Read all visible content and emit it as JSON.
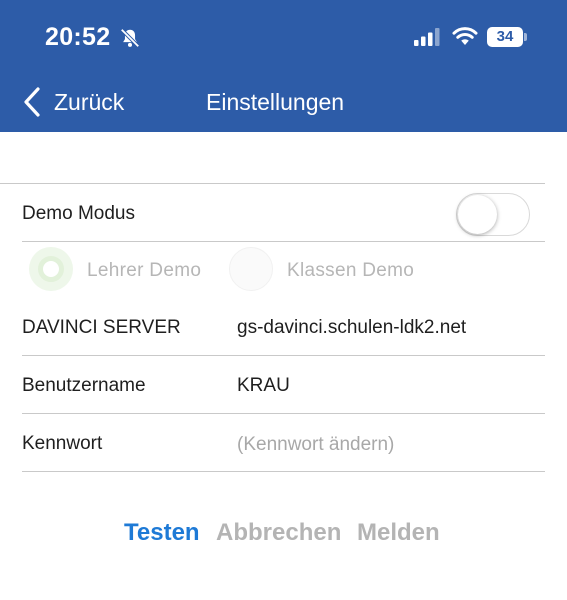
{
  "status_bar": {
    "time": "20:52",
    "battery": "34"
  },
  "nav": {
    "back_label": "Zurück",
    "title": "Einstellungen"
  },
  "settings": {
    "demo_mode": {
      "label": "Demo Modus",
      "enabled": false
    },
    "demo_options": [
      {
        "label": "Lehrer Demo",
        "selected": true
      },
      {
        "label": "Klassen Demo",
        "selected": false
      }
    ],
    "server": {
      "label": "DAVINCI SERVER",
      "value": "gs-davinci.schulen-ldk2.net"
    },
    "username": {
      "label": "Benutzername",
      "value": "KRAU"
    },
    "password": {
      "label": "Kennwort",
      "placeholder": "(Kennwort ändern)"
    }
  },
  "actions": {
    "test": "Testen",
    "cancel": "Abbrechen",
    "report": "Melden"
  },
  "colors": {
    "header_bg": "#2d5ca8",
    "accent": "#1e7ad6",
    "disabled": "#b4b4b4"
  }
}
